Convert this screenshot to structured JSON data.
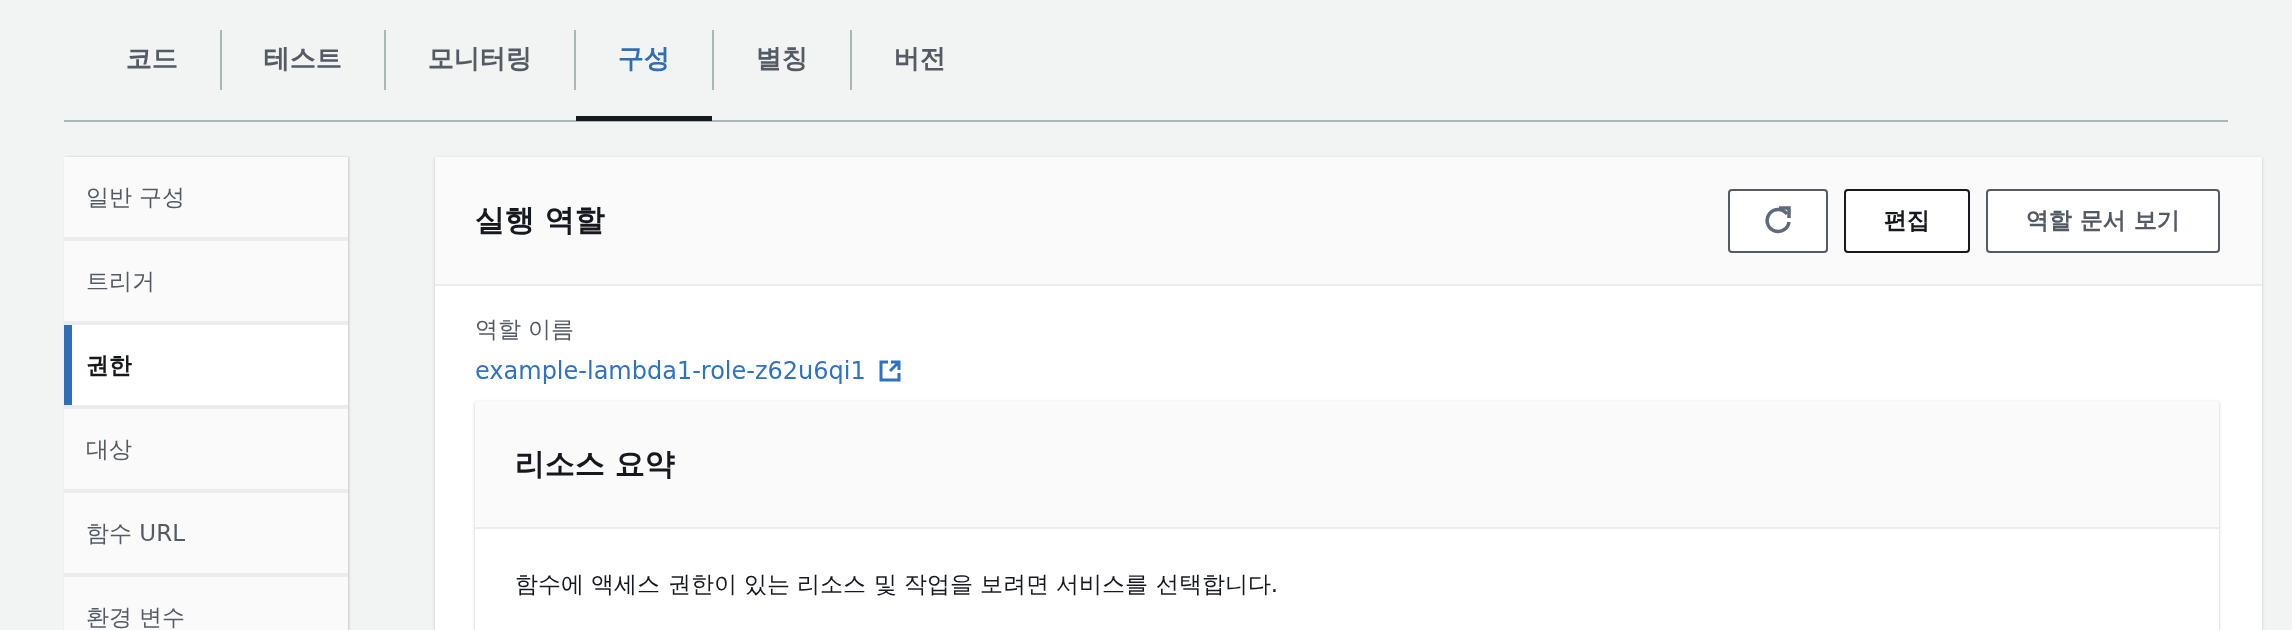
{
  "tabs": [
    {
      "label": "코드",
      "selected": false
    },
    {
      "label": "테스트",
      "selected": false
    },
    {
      "label": "모니터링",
      "selected": false
    },
    {
      "label": "구성",
      "selected": true
    },
    {
      "label": "별칭",
      "selected": false
    },
    {
      "label": "버전",
      "selected": false
    }
  ],
  "sidebar": {
    "items": [
      {
        "label": "일반 구성",
        "selected": false
      },
      {
        "label": "트리거",
        "selected": false
      },
      {
        "label": "권한",
        "selected": true
      },
      {
        "label": "대상",
        "selected": false
      },
      {
        "label": "함수 URL",
        "selected": false
      },
      {
        "label": "환경 변수",
        "selected": false
      }
    ]
  },
  "panel": {
    "title": "실행 역할",
    "buttons": [
      {
        "kind": "refresh"
      },
      {
        "kind": "text",
        "label": "편집",
        "emphasis": true
      },
      {
        "kind": "text",
        "label": "역할 문서 보기",
        "emphasis": false
      }
    ],
    "role_label": "역할 이름",
    "role_link": "example-lambda1-role-z62u6qi1",
    "summary": {
      "title": "리소스 요약",
      "description": "함수에 액세스 권한이 있는 리소스 및 작업을 보려면 서비스를 선택합니다."
    }
  }
}
